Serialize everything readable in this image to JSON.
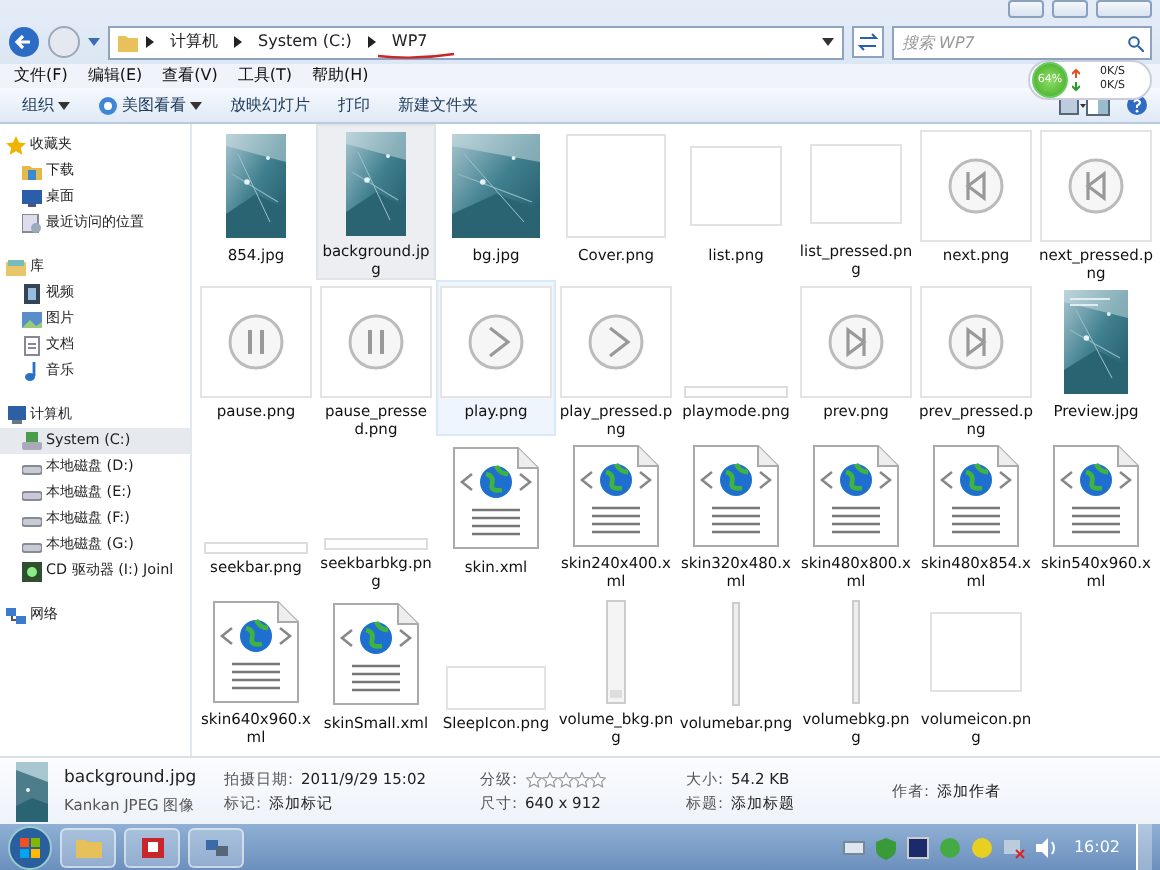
{
  "address": {
    "crumbs": [
      "计算机",
      "System (C:)",
      "WP7"
    ]
  },
  "search": {
    "placeholder": "搜索 WP7"
  },
  "menu": [
    "文件(F)",
    "编辑(E)",
    "查看(V)",
    "工具(T)",
    "帮助(H)"
  ],
  "toolbar": [
    {
      "label": "组织",
      "kind": "plain",
      "dropdown": true
    },
    {
      "label": "美图看看",
      "kind": "app",
      "dropdown": true
    },
    {
      "label": "放映幻灯片",
      "kind": "plain",
      "dropdown": false
    },
    {
      "label": "打印",
      "kind": "plain",
      "dropdown": false
    },
    {
      "label": "新建文件夹",
      "kind": "plain",
      "dropdown": false
    }
  ],
  "net_meter": {
    "percent": "64%",
    "upload": "0K/S",
    "download": "0K/S"
  },
  "sidebar": [
    {
      "label": "收藏夹",
      "kind": "star",
      "children": [
        {
          "label": "下载",
          "kind": "folder",
          "selected": false
        },
        {
          "label": "桌面",
          "kind": "desktop",
          "selected": false
        },
        {
          "label": "最近访问的位置",
          "kind": "recent",
          "selected": false
        }
      ]
    },
    {
      "label": "库",
      "kind": "library",
      "children": [
        {
          "label": "视频",
          "kind": "video",
          "selected": false
        },
        {
          "label": "图片",
          "kind": "picture",
          "selected": false
        },
        {
          "label": "文档",
          "kind": "doc",
          "selected": false
        },
        {
          "label": "音乐",
          "kind": "music",
          "selected": false
        }
      ]
    },
    {
      "label": "计算机",
      "kind": "computer",
      "children": [
        {
          "label": "System (C:)",
          "kind": "sysdrive",
          "selected": true
        },
        {
          "label": "本地磁盘 (D:)",
          "kind": "drive",
          "selected": false
        },
        {
          "label": "本地磁盘 (E:)",
          "kind": "drive",
          "selected": false
        },
        {
          "label": "本地磁盘 (F:)",
          "kind": "drive",
          "selected": false
        },
        {
          "label": "本地磁盘 (G:)",
          "kind": "drive",
          "selected": false
        },
        {
          "label": "CD 驱动器 (I:) Joinl",
          "kind": "cd",
          "selected": false
        }
      ]
    },
    {
      "label": "网络",
      "kind": "network"
    }
  ],
  "files": [
    {
      "name": "854.jpg",
      "selected": false,
      "hover": false
    },
    {
      "name": "background.jpg",
      "selected": true,
      "hover": false
    },
    {
      "name": "bg.jpg",
      "kind": "photo-wide",
      "selected": false,
      "hover": false
    },
    {
      "name": "Cover.png",
      "kind": "blank",
      "selected": false,
      "hover": false
    },
    {
      "name": "list.png",
      "kind": "blank-small",
      "selected": false,
      "hover": false
    },
    {
      "name": "list_pressed.png",
      "kind": "blank-small",
      "selected": false,
      "hover": false
    },
    {
      "name": "next.png",
      "kind": "next",
      "selected": false,
      "hover": false
    },
    {
      "name": "next_pressed.png",
      "kind": "next",
      "selected": false,
      "hover": false
    },
    {
      "name": "pause.png",
      "kind": "pause",
      "selected": false,
      "hover": false
    },
    {
      "name": "pause_pressed.png",
      "kind": "pause",
      "selected": false,
      "hover": false
    },
    {
      "name": "play.png",
      "kind": "play",
      "selected": false,
      "hover": true
    },
    {
      "name": "play_pressed.png",
      "kind": "play",
      "selected": false,
      "hover": false
    },
    {
      "name": "playmode.png",
      "kind": "strip",
      "selected": false,
      "hover": false
    },
    {
      "name": "prev.png",
      "kind": "prev",
      "selected": false,
      "hover": false
    },
    {
      "name": "prev_pressed.png",
      "kind": "prev",
      "selected": false,
      "hover": false
    },
    {
      "name": "Preview.jpg",
      "kind": "preview",
      "selected": false,
      "hover": false
    },
    {
      "name": "seekbar.png",
      "kind": "strip",
      "selected": false,
      "hover": false
    },
    {
      "name": "seekbarbkg.png",
      "kind": "strip",
      "selected": false,
      "hover": false
    },
    {
      "name": "skin.xml",
      "kind": "xml",
      "selected": false,
      "hover": false
    },
    {
      "name": "skin240x400.xml",
      "kind": "xml",
      "selected": false,
      "hover": false
    },
    {
      "name": "skin320x480.xml",
      "kind": "xml",
      "selected": false,
      "hover": false
    },
    {
      "name": "skin480x800.xml",
      "kind": "xml",
      "selected": false,
      "hover": false
    },
    {
      "name": "skin480x854.xml",
      "kind": "xml",
      "selected": false,
      "hover": false
    },
    {
      "name": "skin540x960.xml",
      "kind": "xml",
      "selected": false,
      "hover": false
    },
    {
      "name": "skin640x960.xml",
      "kind": "xml",
      "selected": false,
      "hover": false
    },
    {
      "name": "skinSmall.xml",
      "kind": "xml",
      "selected": false,
      "hover": false
    },
    {
      "name": "SleepIcon.png",
      "kind": "low-blank",
      "selected": false,
      "hover": false
    },
    {
      "name": "volume_bkg.png",
      "kind": "vbar",
      "selected": false,
      "hover": false
    },
    {
      "name": "volumebar.png",
      "kind": "vline",
      "selected": false,
      "hover": false
    },
    {
      "name": "volumebkg.png",
      "kind": "vline",
      "selected": false,
      "hover": false
    },
    {
      "name": "volumeicon.png",
      "kind": "blank-small",
      "selected": false,
      "hover": false
    }
  ],
  "details": {
    "name": "background.jpg",
    "type": "Kankan JPEG 图像",
    "fields": [
      {
        "label": "拍摄日期:",
        "value": "2011/9/29 15:02",
        "kind": "text"
      },
      {
        "label": "标记:",
        "value": "添加标记",
        "kind": "text"
      },
      {
        "label": "分级:",
        "kind": "stars",
        "stars": 0
      },
      {
        "label": "尺寸:",
        "value": "640 x 912",
        "kind": "text"
      },
      {
        "label": "大小:",
        "value": "54.2 KB",
        "kind": "text"
      },
      {
        "label": "标题:",
        "value": "添加标题",
        "kind": "text"
      },
      {
        "label": "作者:",
        "value": "添加作者",
        "kind": "text"
      }
    ]
  },
  "taskbar": {
    "clock": "16:02"
  }
}
